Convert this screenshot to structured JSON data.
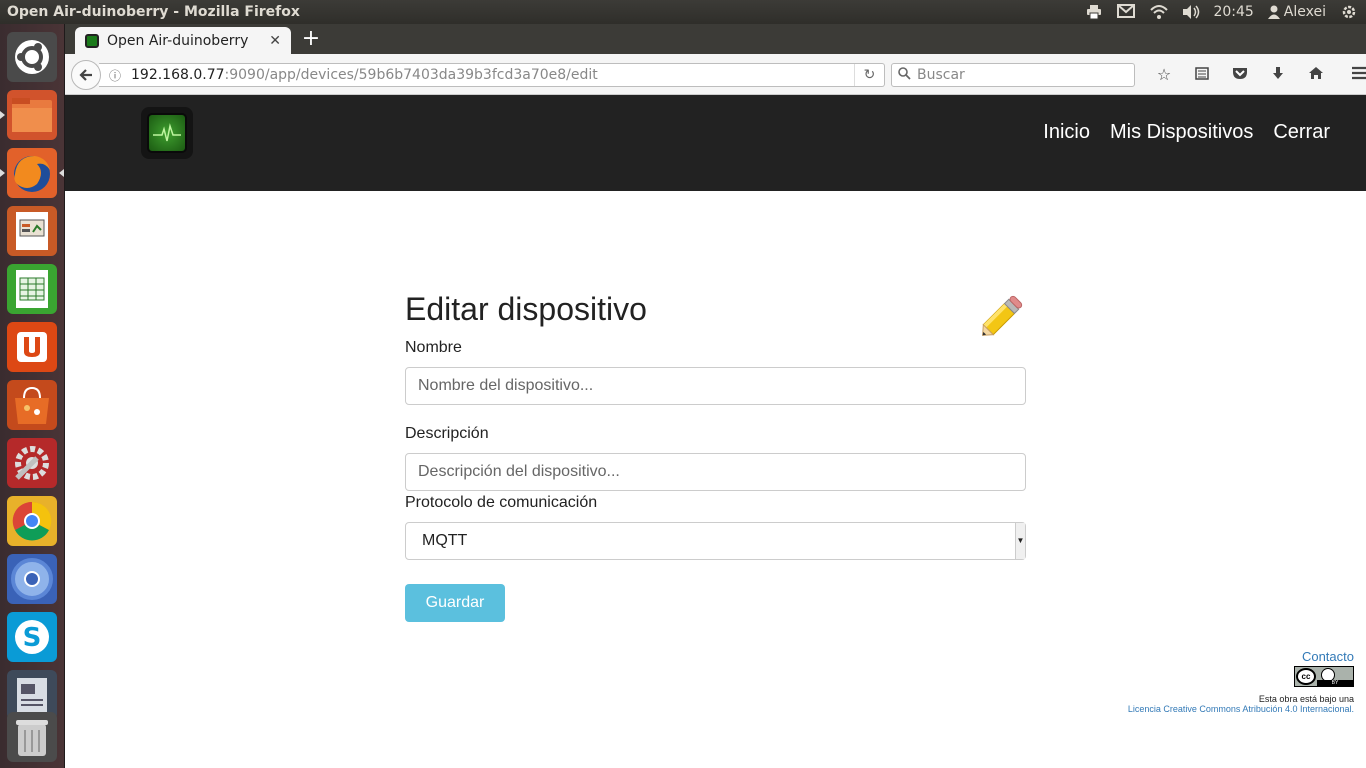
{
  "system_panel": {
    "window_title": "Open Air-duinoberry - Mozilla Firefox",
    "time": "20:45",
    "user": "Alexei",
    "icons": [
      "printer-icon",
      "mail-icon",
      "wifi-icon",
      "volume-icon",
      "user-icon",
      "power-gear-icon"
    ]
  },
  "launcher": {
    "items": [
      "ubuntu-dash",
      "files",
      "firefox",
      "libreoffice-impress",
      "libreoffice-calc",
      "ubuntu-one",
      "software-center",
      "system-settings",
      "chrome",
      "chromium",
      "skype",
      "text-editor",
      "trash"
    ]
  },
  "browser": {
    "tab_title": "Open Air-duinoberry",
    "url_host": "192.168.0.77",
    "url_path": ":9090/app/devices/59b6b7403da39b3fcd3a70e8/edit",
    "search_placeholder": "Buscar"
  },
  "site": {
    "nav": {
      "home": "Inicio",
      "devices": "Mis Dispositivos",
      "logout": "Cerrar"
    },
    "form": {
      "title": "Editar dispositivo",
      "name_label": "Nombre",
      "name_placeholder": "Nombre del dispositivo...",
      "description_label": "Descripción",
      "description_placeholder": "Descripción del dispositivo...",
      "protocol_label": "Protocolo de comunicación",
      "protocol_value": "MQTT",
      "save_label": "Guardar"
    },
    "footer": {
      "contact": "Contacto",
      "license_text": "Esta obra está bajo una",
      "license_link": "Licencia Creative Commons Atribución 4.0 Internacional."
    }
  },
  "colors": {
    "header_bg": "#222222",
    "save_button": "#5bc0de",
    "link": "#337ab7"
  }
}
